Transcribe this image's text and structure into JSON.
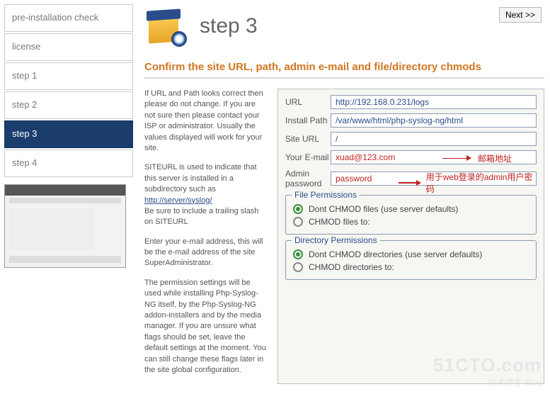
{
  "nav": {
    "items": [
      {
        "label": "pre-installation check",
        "active": false
      },
      {
        "label": "license",
        "active": false
      },
      {
        "label": "step 1",
        "active": false
      },
      {
        "label": "step 2",
        "active": false
      },
      {
        "label": "step 3",
        "active": true
      },
      {
        "label": "step 4",
        "active": false
      }
    ]
  },
  "header": {
    "title": "step 3",
    "next": "Next >>"
  },
  "confirm_heading": "Confirm the site URL, path, admin e-mail and file/directory chmods",
  "instructions": {
    "p1": "If URL and Path looks correct then please do not change. If you are not sure then please contact your ISP or administrator. Usually the values displayed will work for your site.",
    "p2a": "SITEURL is used to indicate that this server is installed in a subdirectory such as ",
    "p2link": "http://server/syslog/",
    "p2b": "Be sure to include a trailing slash on SITEURL",
    "p3": "Enter your e-mail address, this will be the e-mail address of the site SuperAdministrator.",
    "p4": "The permission settings will be used while installing Php-Syslog-NG itself, by the Php-Syslog-NG addon-installers and by the media manager. If you are unsure what flags should be set, leave the default settings at the moment. You can still change these flags later in the site global configuration."
  },
  "form": {
    "url_label": "URL",
    "url_value": "http://192.168.0.231/logs",
    "path_label": "Install Path",
    "path_value": "/var/www/html/php-syslog-ng/html",
    "siteurl_label": "Site URL",
    "siteurl_value": "/",
    "email_label": "Your E-mail",
    "email_value": "xuad@123.com",
    "pwd_label": "Admin password",
    "pwd_value": "password"
  },
  "file_perm": {
    "title": "File Permissions",
    "opt1": "Dont CHMOD files (use server defaults)",
    "opt2": "CHMOD files to:"
  },
  "dir_perm": {
    "title": "Directory Permissions",
    "opt1": "Dont CHMOD directories (use server defaults)",
    "opt2": "CHMOD directories to:"
  },
  "annotations": {
    "email": "邮箱地址",
    "password": "用于web登录的admin用户密码"
  },
  "watermark": {
    "big": "51CTO.com",
    "small": "技术博客  Blog"
  }
}
